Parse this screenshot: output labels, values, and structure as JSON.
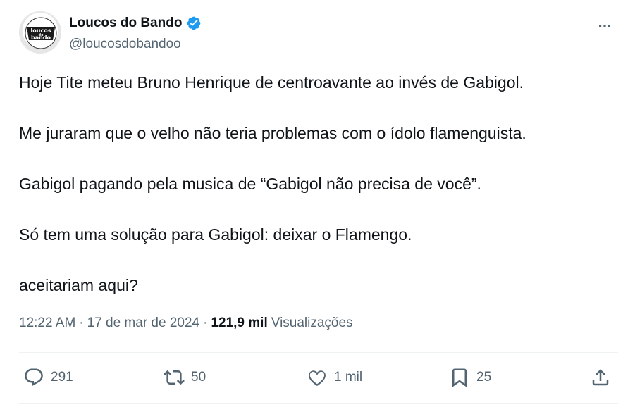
{
  "author": {
    "display_name": "Loucos do Bando",
    "handle": "@loucosdobandoo",
    "avatar_text": [
      "loucos",
      "do",
      "bando"
    ],
    "verified_color": "#1d9bf0"
  },
  "tweet": {
    "paragraphs": [
      "Hoje Tite meteu Bruno Henrique de centroavante ao invés de Gabigol.",
      "Me juraram que o velho não teria problemas com o ídolo flamenguista.",
      "Gabigol pagando pela musica de “Gabigol não precisa de você”.",
      "Só tem uma solução para Gabigol: deixar o Flamengo.",
      "aceitariam aqui?"
    ]
  },
  "meta": {
    "time": "12:22 AM",
    "separator": "·",
    "date": "17 de mar de 2024",
    "views_count": "121,9 mil",
    "views_label": "Visualizações"
  },
  "actions": {
    "replies": "291",
    "retweets": "50",
    "likes": "1 mil",
    "bookmarks": "25"
  },
  "icons": {
    "more": "more-horizontal-icon",
    "reply": "reply-icon",
    "retweet": "retweet-icon",
    "like": "heart-icon",
    "bookmark": "bookmark-icon",
    "share": "share-icon"
  },
  "colors": {
    "text": "#0f1419",
    "secondary": "#536471",
    "divider": "#eff3f4"
  }
}
